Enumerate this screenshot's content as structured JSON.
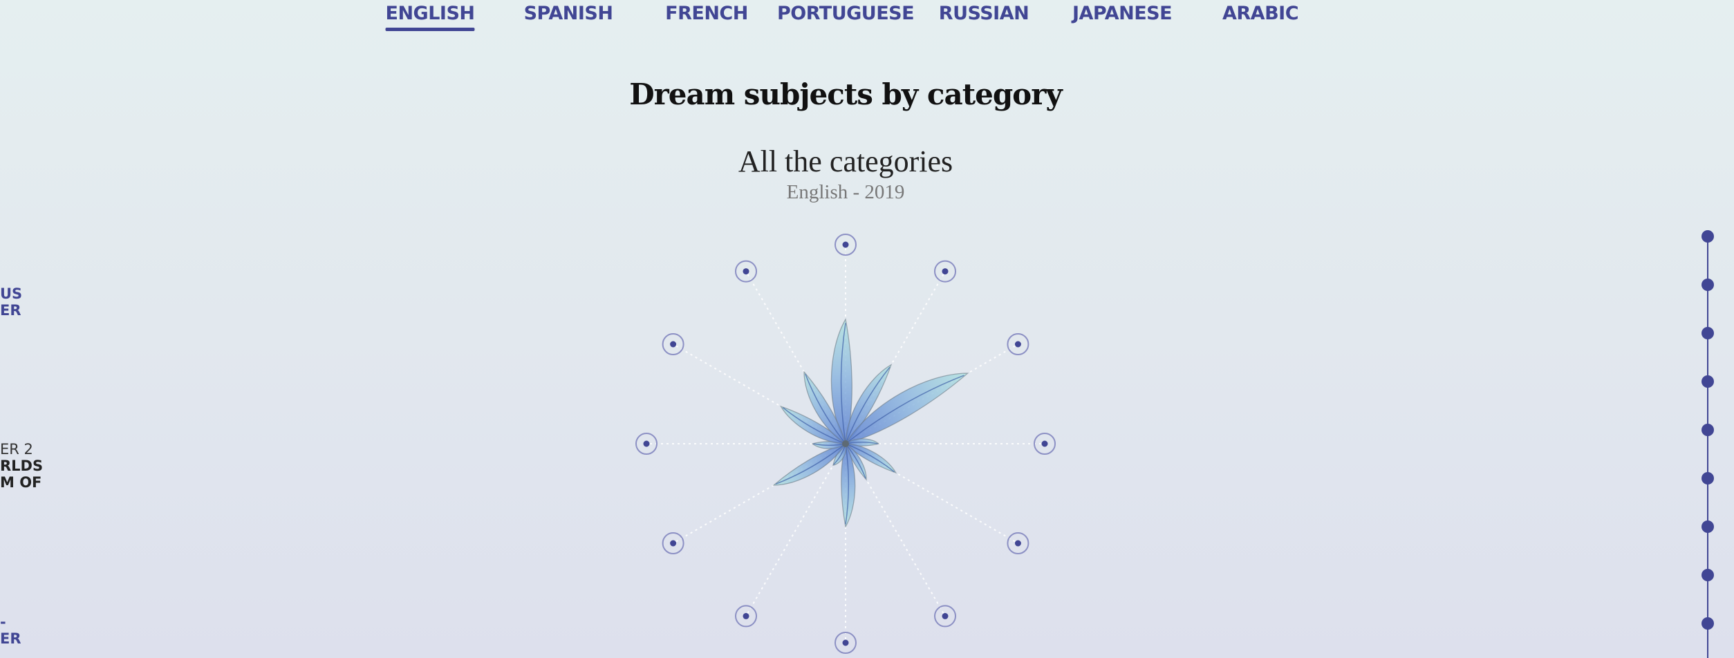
{
  "tabs": [
    {
      "label": "ENGLISH",
      "active": true
    },
    {
      "label": "SPANISH",
      "active": false
    },
    {
      "label": "FRENCH",
      "active": false
    },
    {
      "label": "PORTUGUESE",
      "active": false
    },
    {
      "label": "RUSSIAN",
      "active": false
    },
    {
      "label": "JAPANESE",
      "active": false
    },
    {
      "label": "ARABIC",
      "active": false
    }
  ],
  "title": "Dream subjects by category",
  "subtitle": "All the categories",
  "caption": "English - 2019",
  "left_fragments": {
    "a_line1": "US",
    "a_line2": "ER",
    "b_line1": "ER 2",
    "b_line2": "RLDS",
    "b_line3": "M OF",
    "c_line1": "-",
    "c_line2": "ER"
  },
  "colors": {
    "accent": "#414694",
    "petal_inner": "#5b7fd0",
    "petal_outer": "#b3e3e0"
  },
  "chart_data": {
    "type": "radial",
    "categories": [
      "",
      "",
      "",
      "",
      "",
      "",
      "",
      "",
      "",
      "",
      "",
      ""
    ],
    "values": [
      0.75,
      0.55,
      0.85,
      0.2,
      0.35,
      0.25,
      0.5,
      0.15,
      0.5,
      0.2,
      0.45,
      0.5
    ]
  },
  "timeline": {
    "icon": "timeline-dot-icon",
    "stops": 9
  }
}
